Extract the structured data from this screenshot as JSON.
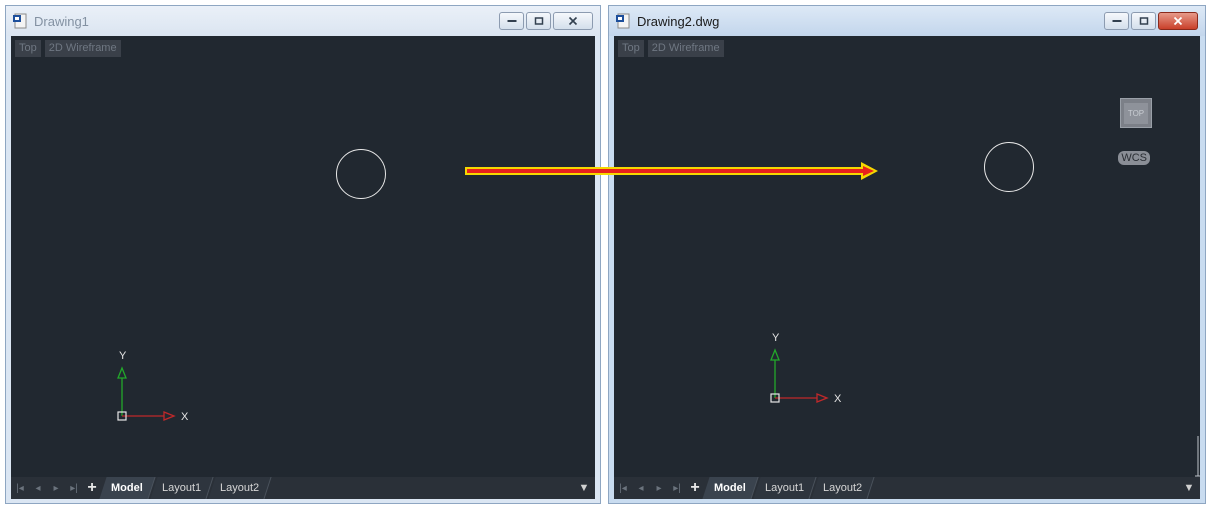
{
  "windows": [
    {
      "title": "Drawing1",
      "view_label": "Top",
      "visual_style_label": "2D Wireframe",
      "tabs": [
        "Model",
        "Layout1",
        "Layout2"
      ],
      "ucs_x": "X",
      "ucs_y": "Y"
    },
    {
      "title": "Drawing2.dwg",
      "view_label": "Top",
      "visual_style_label": "2D Wireframe",
      "tabs": [
        "Model",
        "Layout1",
        "Layout2"
      ],
      "ucs_x": "X",
      "ucs_y": "Y",
      "viewcube_label": "TOP",
      "wcs_label": "WCS"
    }
  ],
  "colors": {
    "viewport_bg": "#212830",
    "arrow_fill": "#e8211c",
    "arrow_outline": "#f5d800",
    "ucs_x_axis": "#c0282a",
    "ucs_y_axis": "#22a82a"
  },
  "icons": [
    "document-icon",
    "minimize-icon",
    "maximize-icon",
    "close-icon",
    "first-tab-icon",
    "prev-tab-icon",
    "next-tab-icon",
    "last-tab-icon",
    "add-layout-icon",
    "tab-dropdown-icon"
  ]
}
